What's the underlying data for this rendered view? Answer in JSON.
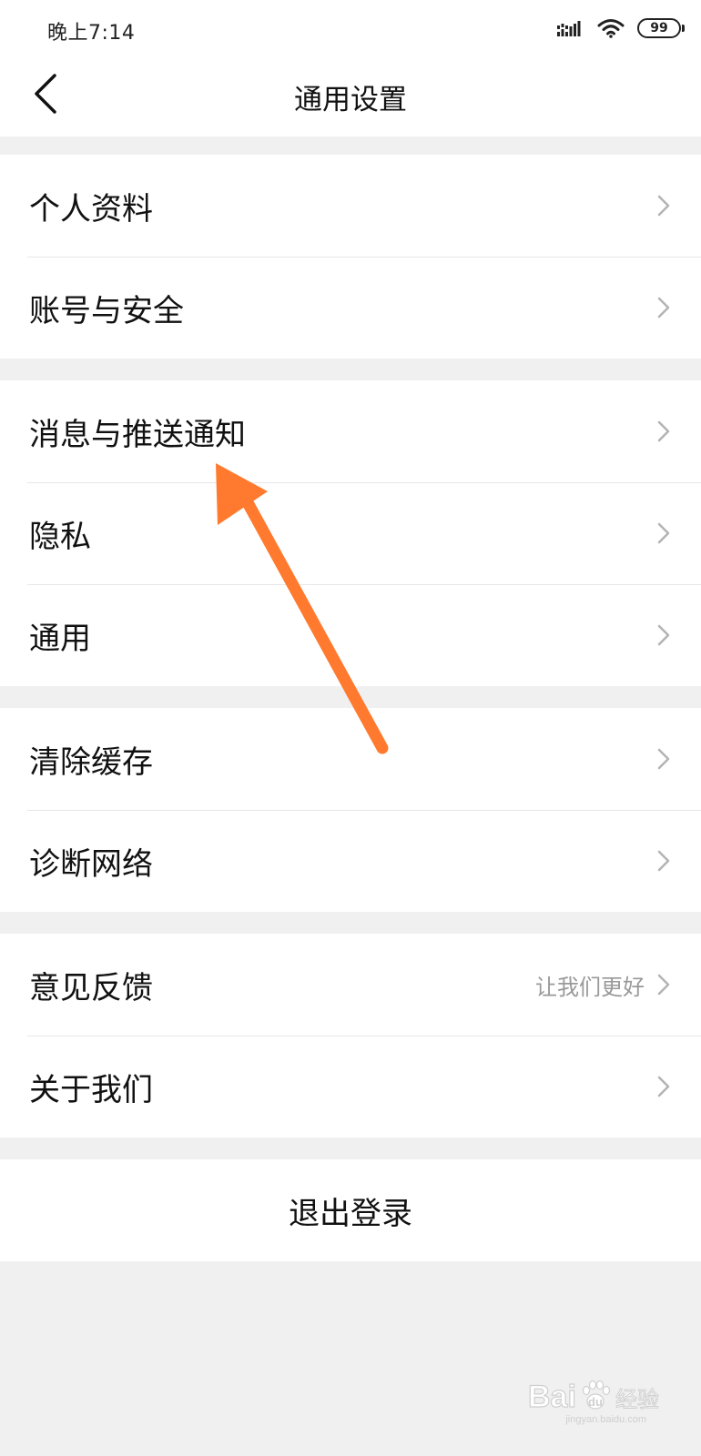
{
  "status_bar": {
    "time": "晚上7:14",
    "battery": "99"
  },
  "header": {
    "title": "通用设置"
  },
  "groups": [
    {
      "items": [
        {
          "label": "个人资料"
        },
        {
          "label": "账号与安全"
        }
      ]
    },
    {
      "items": [
        {
          "label": "消息与推送通知"
        },
        {
          "label": "隐私"
        },
        {
          "label": "通用"
        }
      ]
    },
    {
      "items": [
        {
          "label": "清除缓存"
        },
        {
          "label": "诊断网络"
        }
      ]
    },
    {
      "items": [
        {
          "label": "意见反馈",
          "hint": "让我们更好"
        },
        {
          "label": "关于我们"
        }
      ]
    }
  ],
  "logout": {
    "label": "退出登录"
  },
  "watermark": {
    "brand": "Bai",
    "brand2": "du",
    "suffix": "经验",
    "url": "jingyan.baidu.com"
  },
  "colors": {
    "arrow": "#ff7a2e",
    "background": "#f0f0f0",
    "surface": "#ffffff",
    "hint": "#999999"
  },
  "icons": {
    "back": "chevron-left-icon",
    "row": "chevron-right-icon",
    "signal": "signal-icon",
    "wifi": "wifi-icon",
    "battery": "battery-icon"
  }
}
